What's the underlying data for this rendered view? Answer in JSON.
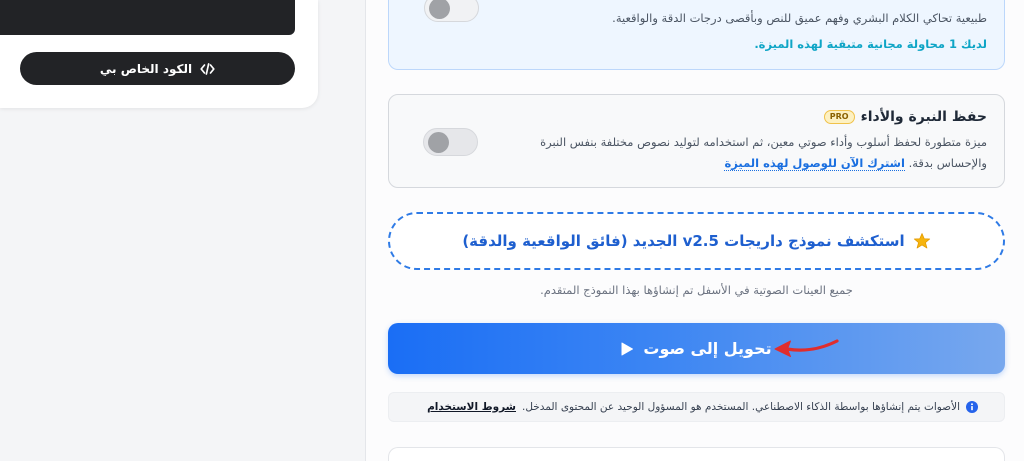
{
  "left_panel": {
    "code_button": {
      "label": "الكود الخاص بي",
      "icon": "code-icon"
    }
  },
  "realism_feature": {
    "description_tail": "طبيعية تحاكي الكلام البشري وفهم عميق للنص وبأقصى درجات الدقة والواقعية.",
    "free_attempts": "لديك 1 محاولة مجانية متبقية لهذه الميزة.",
    "toggle_on": false
  },
  "voice_preservation": {
    "title": "حفظ النبرة والأداء",
    "badge": "PRO",
    "description_line1": "ميزة متطورة لحفظ أسلوب وأداء صوتي معين، ثم استخدامه لتوليد نصوص مختلفة بنفس النبرة",
    "description_line2": "والإحساس بدقة.",
    "subscribe_link": "اشترك الآن للوصول لهذه الميزة",
    "toggle_on": false
  },
  "model_banner": {
    "icon": "star-icon",
    "text": "استكشف نموذج داريجات v2.5 الجديد (فائق الواقعية والدقة)"
  },
  "samples_note": "جميع العينات الصوتية في الأسفل تم إنشاؤها بهذا النموذج المتقدم.",
  "convert_button": {
    "label": "تحويل إلى صوت",
    "icon": "play-icon"
  },
  "disclaimer": {
    "icon": "info-icon",
    "text": "الأصوات يتم إنشاؤها بواسطة الذكاء الاصطناعي. المستخدم هو المسؤول الوحيد عن المحتوى المدخل.",
    "terms_link": "شروط الاستخدام"
  },
  "colors": {
    "dark": "#222326",
    "teal": "#0ea5c6",
    "link": "#1a6fe0",
    "banner": "#1e5fcf",
    "dashed": "#2f7be6",
    "btn-start": "#1a6ef5",
    "btn-end": "#78a8ee",
    "info": "#2563eb",
    "annotation": "#e02d2d",
    "pro-bg": "#fdf1c2",
    "pro-border": "#f0c24a"
  }
}
